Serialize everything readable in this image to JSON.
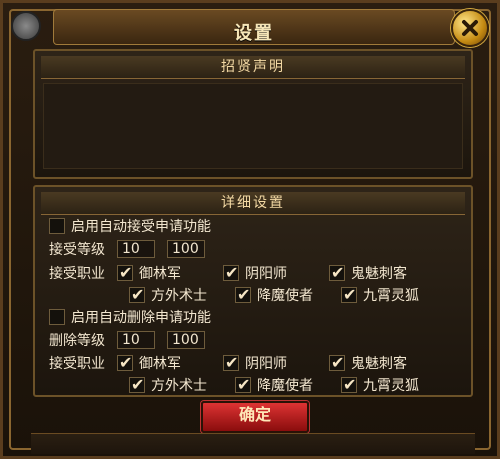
{
  "window": {
    "title": "设置"
  },
  "sections": {
    "announcement": {
      "title": "招贤声明"
    },
    "details": {
      "title": "详细设置"
    }
  },
  "auto_accept": {
    "toggle_label": "启用自动接受申请功能",
    "level_label": "接受等级",
    "level_min": "10",
    "level_max": "100",
    "jobs_label": "接受职业",
    "jobs": [
      {
        "label": "御林军",
        "checked": true
      },
      {
        "label": "阴阳师",
        "checked": true
      },
      {
        "label": "鬼魅刺客",
        "checked": true
      },
      {
        "label": "方外术士",
        "checked": true
      },
      {
        "label": "降魔使者",
        "checked": true
      },
      {
        "label": "九霄灵狐",
        "checked": true
      }
    ]
  },
  "auto_delete": {
    "toggle_label": "启用自动删除申请功能",
    "level_label": "删除等级",
    "level_min": "10",
    "level_max": "100",
    "jobs_label": "接受职业",
    "jobs": [
      {
        "label": "御林军",
        "checked": true
      },
      {
        "label": "阴阳师",
        "checked": true
      },
      {
        "label": "鬼魅刺客",
        "checked": true
      },
      {
        "label": "方外术士",
        "checked": true
      },
      {
        "label": "降魔使者",
        "checked": true
      },
      {
        "label": "九霄灵狐",
        "checked": true
      }
    ]
  },
  "buttons": {
    "confirm": "确定"
  }
}
